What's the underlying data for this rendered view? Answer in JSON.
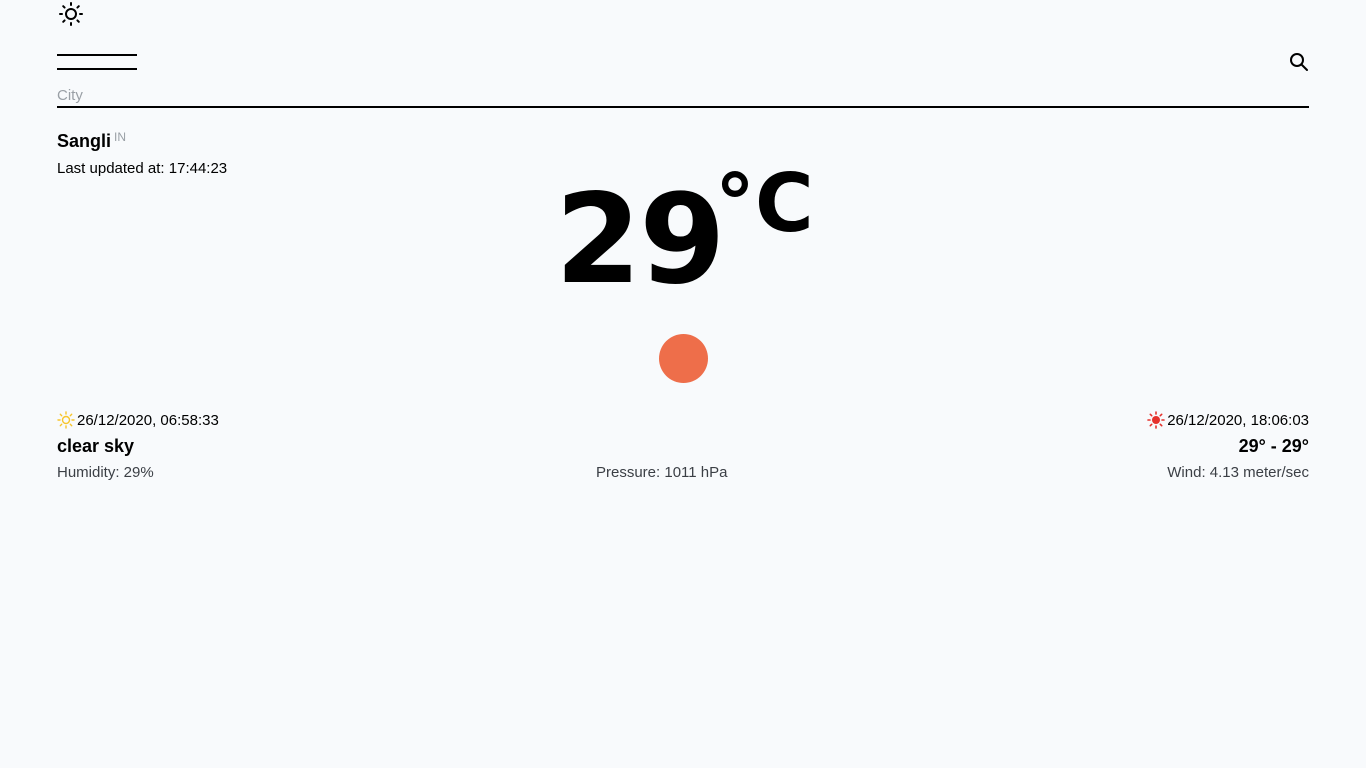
{
  "header": {
    "theme_toggle_icon": "sun-icon",
    "menu_icon": "menu-lines-icon",
    "search_icon": "search-icon"
  },
  "search": {
    "placeholder": "City",
    "value": ""
  },
  "location": {
    "city": "Sangli",
    "country": "IN",
    "last_updated": "Last updated at: 17:44:23"
  },
  "current": {
    "temperature": "29",
    "unit": "°C",
    "condition_icon": "weather-dot-icon",
    "condition_icon_color": "#ee6e4a"
  },
  "details": {
    "sunrise": "26/12/2020, 06:58:33",
    "sunrise_icon_color": "#f7c52b",
    "sunset": "26/12/2020, 18:06:03",
    "sunset_icon_color": "#e5322d",
    "description": "clear sky",
    "range": "29° - 29°",
    "humidity": "Humidity: 29%",
    "pressure": "Pressure: 1011 hPa",
    "wind": "Wind: 4.13 meter/sec"
  }
}
